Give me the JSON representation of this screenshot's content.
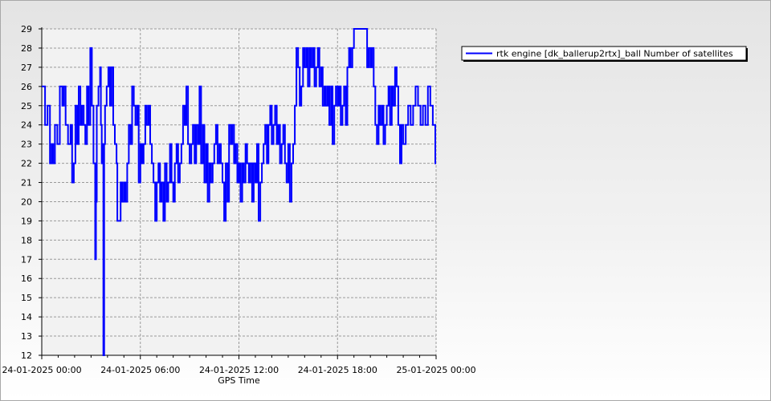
{
  "chart_data": {
    "type": "line",
    "title": "",
    "xlabel": "GPS Time",
    "ylabel": "",
    "xlim": [
      "24-01-2025 00:00",
      "25-01-2025 00:00"
    ],
    "ylim": [
      12,
      29
    ],
    "y_ticks": [
      12,
      13,
      14,
      15,
      16,
      17,
      18,
      19,
      20,
      21,
      22,
      23,
      24,
      25,
      26,
      27,
      28,
      29
    ],
    "x_ticks": [
      {
        "label": "24-01-2025 00:00",
        "hours": 0
      },
      {
        "label": "24-01-2025 06:00",
        "hours": 6
      },
      {
        "label": "24-01-2025 12:00",
        "hours": 12
      },
      {
        "label": "24-01-2025 18:00",
        "hours": 18
      },
      {
        "label": "25-01-2025 00:00",
        "hours": 24
      }
    ],
    "grid": true,
    "legend_position": "top-right",
    "x_unit_note": "",
    "series": [
      {
        "name": "rtk engine [dk_ballerup2rtx]_ball Number of satellites",
        "color": "#0000ff",
        "step": true,
        "points": [
          [
            0.0,
            26
          ],
          [
            0.2,
            24
          ],
          [
            0.35,
            25
          ],
          [
            0.5,
            22
          ],
          [
            0.6,
            23
          ],
          [
            0.7,
            22
          ],
          [
            0.8,
            24
          ],
          [
            0.95,
            23
          ],
          [
            1.1,
            26
          ],
          [
            1.25,
            25
          ],
          [
            1.35,
            26
          ],
          [
            1.45,
            24
          ],
          [
            1.6,
            23
          ],
          [
            1.75,
            24
          ],
          [
            1.85,
            21
          ],
          [
            1.95,
            22
          ],
          [
            2.05,
            25
          ],
          [
            2.15,
            23
          ],
          [
            2.25,
            26
          ],
          [
            2.35,
            24
          ],
          [
            2.45,
            25
          ],
          [
            2.55,
            24
          ],
          [
            2.65,
            23
          ],
          [
            2.75,
            26
          ],
          [
            2.85,
            24
          ],
          [
            2.95,
            28
          ],
          [
            3.05,
            25
          ],
          [
            3.15,
            22
          ],
          [
            3.25,
            17
          ],
          [
            3.3,
            20
          ],
          [
            3.35,
            25
          ],
          [
            3.45,
            26
          ],
          [
            3.55,
            27
          ],
          [
            3.6,
            24
          ],
          [
            3.65,
            22
          ],
          [
            3.7,
            23
          ],
          [
            3.75,
            12
          ],
          [
            3.8,
            23
          ],
          [
            3.85,
            25
          ],
          [
            3.95,
            26
          ],
          [
            4.05,
            27
          ],
          [
            4.15,
            25
          ],
          [
            4.25,
            27
          ],
          [
            4.35,
            24
          ],
          [
            4.45,
            23
          ],
          [
            4.55,
            22
          ],
          [
            4.6,
            19
          ],
          [
            4.7,
            19
          ],
          [
            4.8,
            21
          ],
          [
            4.9,
            20
          ],
          [
            5.0,
            21
          ],
          [
            5.1,
            20
          ],
          [
            5.2,
            22
          ],
          [
            5.3,
            24
          ],
          [
            5.4,
            23
          ],
          [
            5.5,
            26
          ],
          [
            5.6,
            25
          ],
          [
            5.7,
            24
          ],
          [
            5.8,
            25
          ],
          [
            5.9,
            21
          ],
          [
            6.0,
            23
          ],
          [
            6.1,
            22
          ],
          [
            6.2,
            23
          ],
          [
            6.3,
            25
          ],
          [
            6.4,
            24
          ],
          [
            6.5,
            25
          ],
          [
            6.6,
            23
          ],
          [
            6.7,
            22
          ],
          [
            6.8,
            21
          ],
          [
            6.9,
            19
          ],
          [
            7.0,
            21
          ],
          [
            7.1,
            22
          ],
          [
            7.2,
            20
          ],
          [
            7.3,
            21
          ],
          [
            7.4,
            19
          ],
          [
            7.5,
            22
          ],
          [
            7.6,
            20
          ],
          [
            7.7,
            21
          ],
          [
            7.8,
            23
          ],
          [
            7.9,
            21
          ],
          [
            8.0,
            20
          ],
          [
            8.1,
            22
          ],
          [
            8.2,
            23
          ],
          [
            8.3,
            21
          ],
          [
            8.4,
            22
          ],
          [
            8.5,
            23
          ],
          [
            8.6,
            25
          ],
          [
            8.7,
            24
          ],
          [
            8.8,
            26
          ],
          [
            8.9,
            23
          ],
          [
            9.0,
            22
          ],
          [
            9.1,
            23
          ],
          [
            9.2,
            24
          ],
          [
            9.3,
            22
          ],
          [
            9.4,
            24
          ],
          [
            9.5,
            23
          ],
          [
            9.6,
            26
          ],
          [
            9.7,
            22
          ],
          [
            9.8,
            24
          ],
          [
            9.9,
            21
          ],
          [
            10.0,
            23
          ],
          [
            10.1,
            20
          ],
          [
            10.2,
            22
          ],
          [
            10.3,
            21
          ],
          [
            10.4,
            22
          ],
          [
            10.5,
            23
          ],
          [
            10.6,
            24
          ],
          [
            10.7,
            22
          ],
          [
            10.8,
            23
          ],
          [
            10.9,
            22
          ],
          [
            11.0,
            21
          ],
          [
            11.1,
            19
          ],
          [
            11.2,
            22
          ],
          [
            11.3,
            20
          ],
          [
            11.4,
            24
          ],
          [
            11.5,
            23
          ],
          [
            11.6,
            24
          ],
          [
            11.7,
            22
          ],
          [
            11.8,
            23
          ],
          [
            11.9,
            21
          ],
          [
            12.0,
            22
          ],
          [
            12.1,
            20
          ],
          [
            12.2,
            22
          ],
          [
            12.3,
            21
          ],
          [
            12.4,
            23
          ],
          [
            12.5,
            22
          ],
          [
            12.6,
            21
          ],
          [
            12.7,
            22
          ],
          [
            12.8,
            20
          ],
          [
            12.9,
            22
          ],
          [
            13.0,
            21
          ],
          [
            13.1,
            23
          ],
          [
            13.2,
            19
          ],
          [
            13.3,
            21
          ],
          [
            13.4,
            22
          ],
          [
            13.5,
            23
          ],
          [
            13.6,
            24
          ],
          [
            13.7,
            22
          ],
          [
            13.8,
            24
          ],
          [
            13.9,
            25
          ],
          [
            14.0,
            23
          ],
          [
            14.1,
            24
          ],
          [
            14.2,
            25
          ],
          [
            14.3,
            23
          ],
          [
            14.4,
            24
          ],
          [
            14.5,
            22
          ],
          [
            14.6,
            23
          ],
          [
            14.7,
            24
          ],
          [
            14.8,
            22
          ],
          [
            14.9,
            21
          ],
          [
            15.0,
            23
          ],
          [
            15.1,
            20
          ],
          [
            15.2,
            22
          ],
          [
            15.3,
            23
          ],
          [
            15.4,
            25
          ],
          [
            15.5,
            28
          ],
          [
            15.6,
            27
          ],
          [
            15.7,
            25
          ],
          [
            15.8,
            26
          ],
          [
            15.9,
            28
          ],
          [
            16.0,
            27
          ],
          [
            16.1,
            28
          ],
          [
            16.2,
            26
          ],
          [
            16.3,
            28
          ],
          [
            16.4,
            27
          ],
          [
            16.5,
            28
          ],
          [
            16.6,
            26
          ],
          [
            16.7,
            27
          ],
          [
            16.8,
            28
          ],
          [
            16.9,
            26
          ],
          [
            17.0,
            27
          ],
          [
            17.1,
            25
          ],
          [
            17.2,
            26
          ],
          [
            17.3,
            25
          ],
          [
            17.4,
            26
          ],
          [
            17.5,
            24
          ],
          [
            17.6,
            26
          ],
          [
            17.7,
            23
          ],
          [
            17.8,
            25
          ],
          [
            17.9,
            26
          ],
          [
            18.0,
            25
          ],
          [
            18.1,
            26
          ],
          [
            18.2,
            24
          ],
          [
            18.3,
            25
          ],
          [
            18.4,
            26
          ],
          [
            18.5,
            24
          ],
          [
            18.6,
            27
          ],
          [
            18.7,
            28
          ],
          [
            18.8,
            27
          ],
          [
            18.9,
            28
          ],
          [
            19.0,
            29
          ],
          [
            19.2,
            29
          ],
          [
            19.4,
            29
          ],
          [
            19.6,
            29
          ],
          [
            19.8,
            27
          ],
          [
            19.9,
            28
          ],
          [
            20.0,
            27
          ],
          [
            20.1,
            28
          ],
          [
            20.2,
            26
          ],
          [
            20.3,
            24
          ],
          [
            20.4,
            23
          ],
          [
            20.5,
            25
          ],
          [
            20.6,
            24
          ],
          [
            20.7,
            25
          ],
          [
            20.8,
            23
          ],
          [
            20.9,
            24
          ],
          [
            21.0,
            25
          ],
          [
            21.1,
            26
          ],
          [
            21.2,
            24
          ],
          [
            21.3,
            26
          ],
          [
            21.4,
            25
          ],
          [
            21.5,
            27
          ],
          [
            21.6,
            26
          ],
          [
            21.7,
            24
          ],
          [
            21.8,
            22
          ],
          [
            21.9,
            24
          ],
          [
            22.0,
            23
          ],
          [
            22.15,
            24
          ],
          [
            22.3,
            25
          ],
          [
            22.45,
            24
          ],
          [
            22.6,
            25
          ],
          [
            22.75,
            26
          ],
          [
            22.9,
            25
          ],
          [
            23.05,
            24
          ],
          [
            23.2,
            25
          ],
          [
            23.35,
            24
          ],
          [
            23.5,
            26
          ],
          [
            23.65,
            25
          ],
          [
            23.8,
            24
          ],
          [
            23.95,
            22
          ]
        ]
      }
    ]
  }
}
